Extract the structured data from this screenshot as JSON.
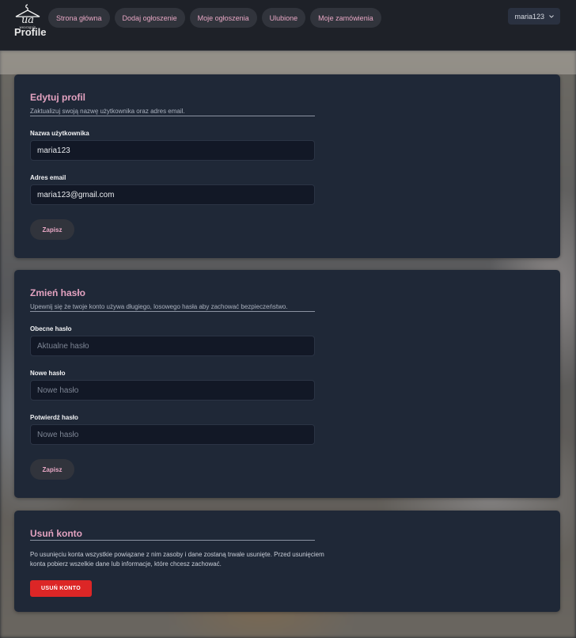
{
  "brand": {
    "logo_text": "wearagain"
  },
  "nav": {
    "items": [
      {
        "label": "Strona główna"
      },
      {
        "label": "Dodaj ogłoszenie"
      },
      {
        "label": "Moje ogłoszenia"
      },
      {
        "label": "Ulubione"
      },
      {
        "label": "Moje zamówienia"
      }
    ]
  },
  "user_menu": {
    "username": "maria123",
    "icon": "chevron-down-icon"
  },
  "page": {
    "title": "Profile"
  },
  "edit_profile": {
    "title": "Edytuj profil",
    "subtitle": "Zaktualizuj swoją nazwę użytkownika oraz adres email.",
    "username_label": "Nazwa użytkownika",
    "username_value": "maria123",
    "email_label": "Adres email",
    "email_value": "maria123@gmail.com",
    "save_label": "Zapisz"
  },
  "change_password": {
    "title": "Zmień hasło",
    "subtitle": "Upewnij się że twoje konto używa długiego, losowego hasła aby zachować bezpieczeństwo.",
    "current_label": "Obecne hasło",
    "current_placeholder": "Aktualne hasło",
    "new_label": "Nowe hasło",
    "new_placeholder": "Nowe hasło",
    "confirm_label": "Potwierdź hasło",
    "confirm_placeholder": "Nowe hasło",
    "save_label": "Zapisz"
  },
  "delete_account": {
    "title": "Usuń konto",
    "description": "Po usunięciu konta wszystkie powiązane z nim zasoby i dane zostaną trwale usunięte. Przed usunięciem konta pobierz wszelkie dane lub informacje, które chcesz zachować.",
    "button_label": "USUŃ KONTO"
  },
  "colors": {
    "accent_pink": "#e7a7c4",
    "card_bg": "#1f2837",
    "danger": "#dc2626",
    "header_bg": "#1e2128"
  }
}
